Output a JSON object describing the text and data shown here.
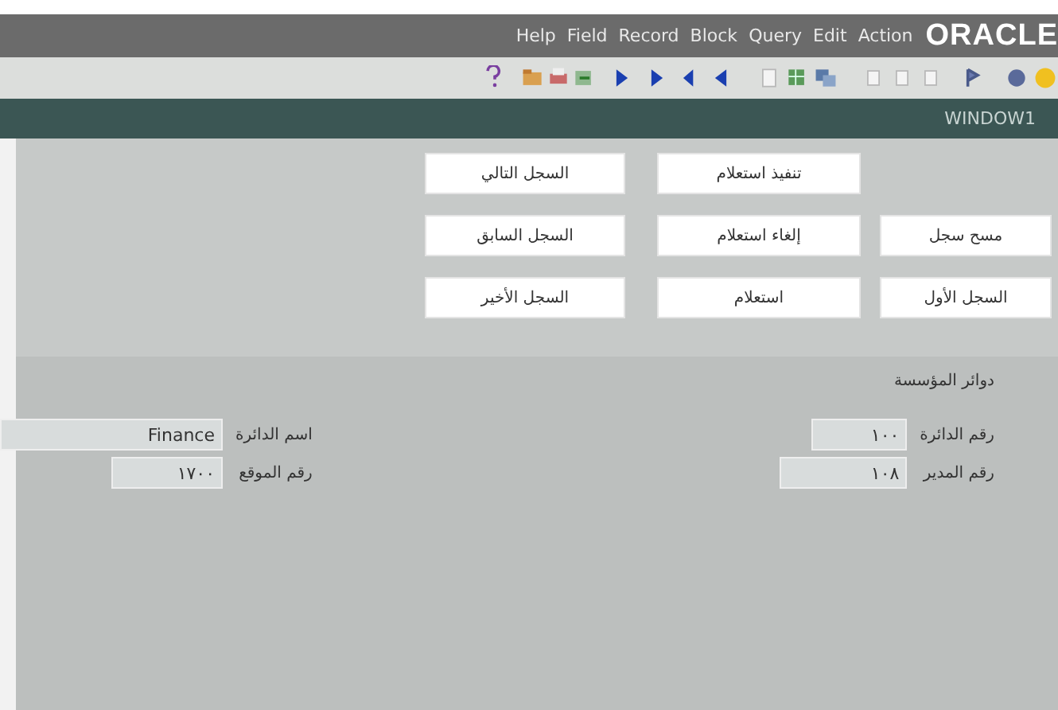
{
  "menu_bar": {
    "items": [
      "Action",
      "Edit",
      "Query",
      "Block",
      "Record",
      "Field",
      "Help"
    ],
    "logo": "ORACLE"
  },
  "window": {
    "title": "WINDOW1"
  },
  "button_columns": [
    [
      "مسح سجل",
      "السجل الأول"
    ],
    [
      "تنفيذ استعلام",
      "إلغاء استعلام",
      "استعلام"
    ],
    [
      "السجل التالي",
      "السجل السابق",
      "السجل الأخير"
    ]
  ],
  "section": {
    "title": "دوائر المؤسسة"
  },
  "field_groups": [
    [
      {
        "label": "رقم الدائرة",
        "value": "١٠٠"
      },
      {
        "label": "رقم المدير",
        "value": "١٠٨"
      }
    ],
    [
      {
        "label": "اسم الدائرة",
        "value": "Finance"
      },
      {
        "label": "رقم الموقع",
        "value": "١٧٠٠"
      }
    ]
  ]
}
